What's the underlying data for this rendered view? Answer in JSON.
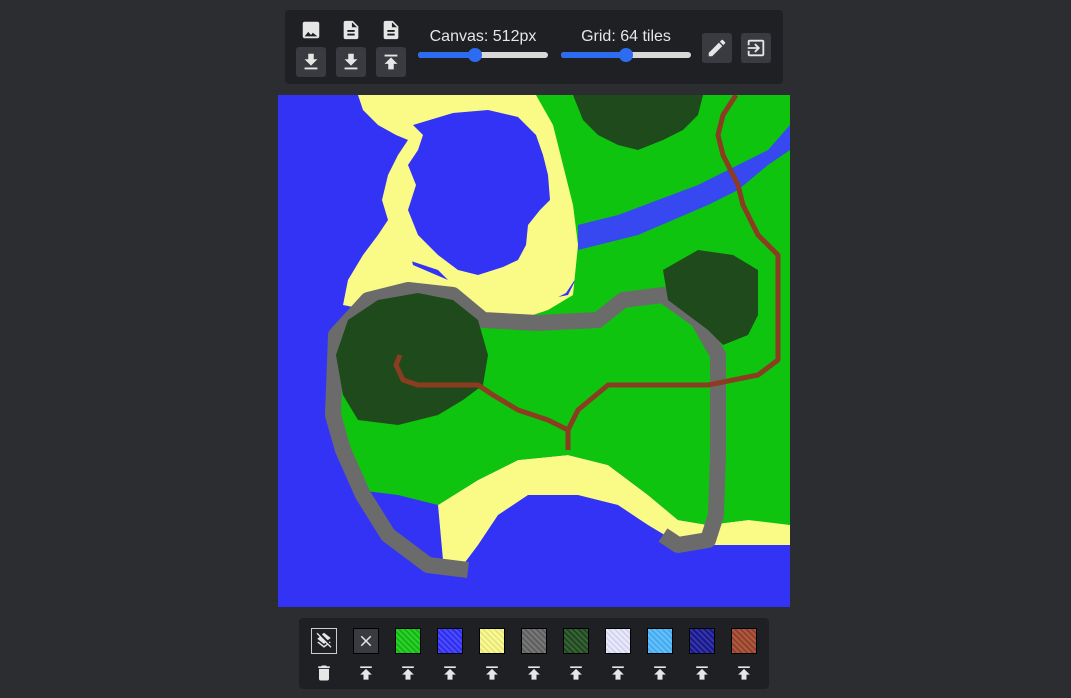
{
  "toolbar": {
    "canvas_label": "Canvas: 512px",
    "canvas_value": 512,
    "canvas_fraction": 0.44,
    "grid_label": "Grid: 64 tiles",
    "grid_value": 64,
    "grid_fraction": 0.5,
    "buttons_top": [
      "image-icon",
      "file-icon",
      "file-icon"
    ],
    "buttons_bottom": [
      "download-icon",
      "download-icon",
      "upload-icon"
    ]
  },
  "colors": {
    "background": "#2c2d31",
    "panel": "#1f2024",
    "accent": "#2d6cf0",
    "water": "#3333f5",
    "sand": "#fafa86",
    "grass": "#0fc40f",
    "forest": "#1e4a1c",
    "stone": "#6b6b6b",
    "river": "#3848f0",
    "path": "#8a3d20"
  },
  "palette": {
    "tiles": [
      {
        "name": "layers",
        "color": "#1f2024"
      },
      {
        "name": "erase",
        "color": "#3a3b40"
      },
      {
        "name": "grass",
        "color": "#14c814"
      },
      {
        "name": "water",
        "color": "#3333ff"
      },
      {
        "name": "sand",
        "color": "#fafa86"
      },
      {
        "name": "stone",
        "color": "#666666"
      },
      {
        "name": "forest",
        "color": "#1f4d1f"
      },
      {
        "name": "snow",
        "color": "#e6e6ff"
      },
      {
        "name": "ice",
        "color": "#4db8ff"
      },
      {
        "name": "deep-water",
        "color": "#1a1a99"
      },
      {
        "name": "brick",
        "color": "#a0442a"
      }
    ]
  }
}
